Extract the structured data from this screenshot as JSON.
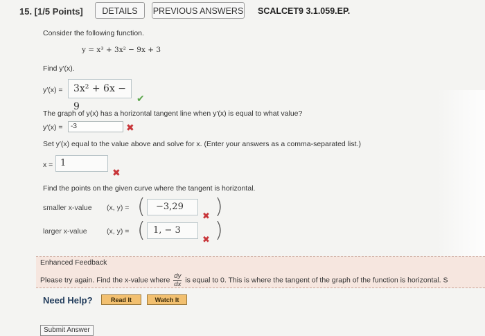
{
  "header": {
    "question_number": "15. [1/5 Points]",
    "details_label": "DETAILS",
    "previous_answers_label": "PREVIOUS ANSWERS",
    "identifier": "SCALCET9 3.1.059.EP."
  },
  "intro": {
    "instruction": "Consider the following function.",
    "function": "y = x³ + 3x² − 9x + 3"
  },
  "part1": {
    "prompt": "Find y′(x).",
    "label": "y′(x) =",
    "answer": "3x² + 6x − 9",
    "status": "correct"
  },
  "part2": {
    "prompt": "The graph of y(x) has a horizontal tangent line when y′(x) is equal to what value?",
    "label": "y′(x) =",
    "value": "-3",
    "status": "incorrect"
  },
  "part3": {
    "prompt": "Set y′(x) equal to the value above and solve for x. (Enter your answers as a comma-separated list.)",
    "label": "x =",
    "value": "1",
    "status": "incorrect"
  },
  "part4": {
    "prompt": "Find the points on the given curve where the tangent is horizontal.",
    "smaller_label": "smaller x-value",
    "larger_label": "larger x-value",
    "point_label": "(x, y) =",
    "smaller_value": "−3,29",
    "larger_value": "1, − 3",
    "status": "incorrect"
  },
  "feedback": {
    "title": "Enhanced Feedback",
    "text_before": "Please try again. Find the x-value where",
    "frac_num": "dy",
    "frac_den": "dx",
    "text_after": "is equal to 0. This is where the tangent of the graph of the function is horizontal. S"
  },
  "help": {
    "label": "Need Help?",
    "read_it": "Read It",
    "watch_it": "Watch It"
  },
  "submit_label": "Submit Answer",
  "colors": {
    "correct": "#5aa64a",
    "incorrect": "#c8363a",
    "feedback_bg": "#f6e6df",
    "help_button": "#f2c070"
  }
}
